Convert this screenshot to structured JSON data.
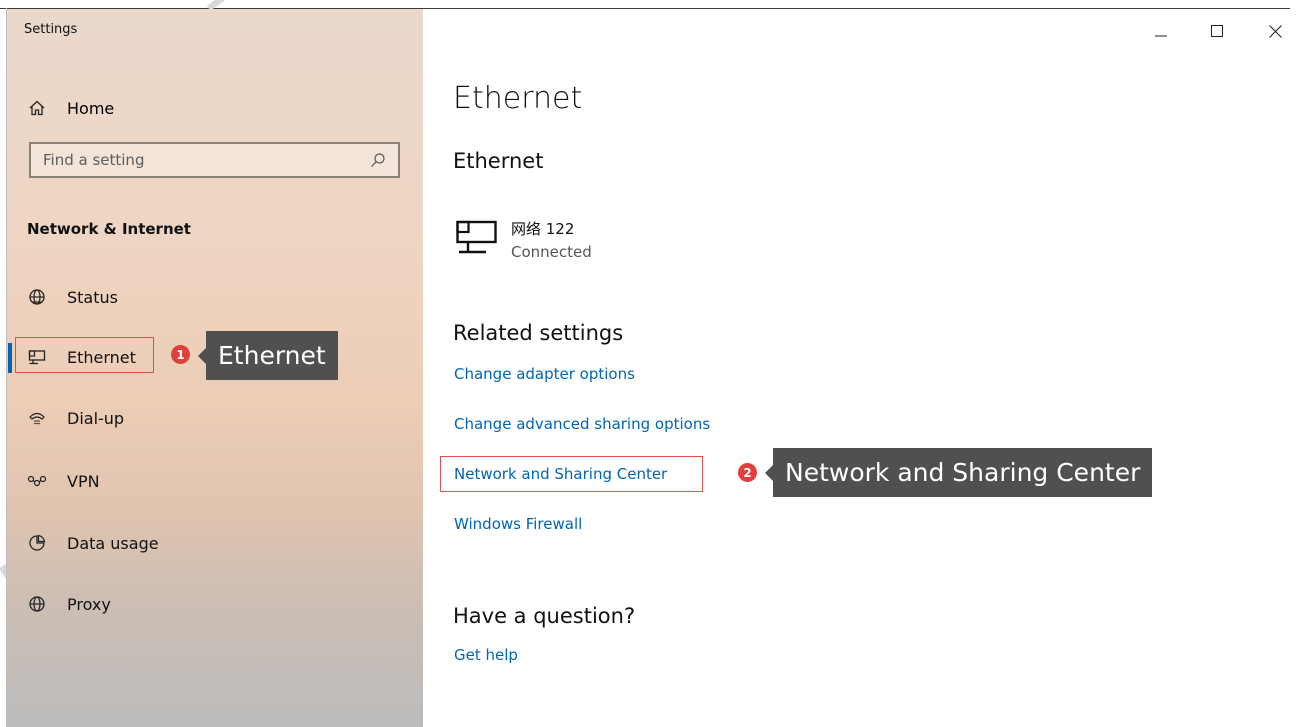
{
  "window": {
    "title": "Settings",
    "minimize_glyph": "–",
    "maximize_glyph": "☐",
    "close_glyph": "✕"
  },
  "sidebar": {
    "home_label": "Home",
    "search_placeholder": "Find a setting",
    "section_title": "Network & Internet",
    "items": [
      {
        "label": "Status",
        "icon": "status-globe-icon"
      },
      {
        "label": "Ethernet",
        "icon": "ethernet-icon",
        "selected": true
      },
      {
        "label": "Dial-up",
        "icon": "dial-up-icon"
      },
      {
        "label": "VPN",
        "icon": "vpn-icon"
      },
      {
        "label": "Data usage",
        "icon": "data-usage-icon"
      },
      {
        "label": "Proxy",
        "icon": "proxy-globe-icon"
      }
    ]
  },
  "main": {
    "page_title": "Ethernet",
    "subtitle": "Ethernet",
    "network": {
      "name": "网络 122",
      "status": "Connected"
    },
    "related_title": "Related settings",
    "related_links": [
      "Change adapter options",
      "Change advanced sharing options",
      "Network and Sharing Center",
      "Windows Firewall"
    ],
    "question_title": "Have a question?",
    "help_link": "Get help"
  },
  "annotations": [
    {
      "number": "1",
      "text": "Ethernet"
    },
    {
      "number": "2",
      "text": "Network and Sharing Center"
    }
  ],
  "colors": {
    "accent": "#0063b1",
    "link": "#0064b8",
    "highlight_box": "#e0504d",
    "badge": "#e23f3f",
    "callout_bg": "#505050"
  }
}
